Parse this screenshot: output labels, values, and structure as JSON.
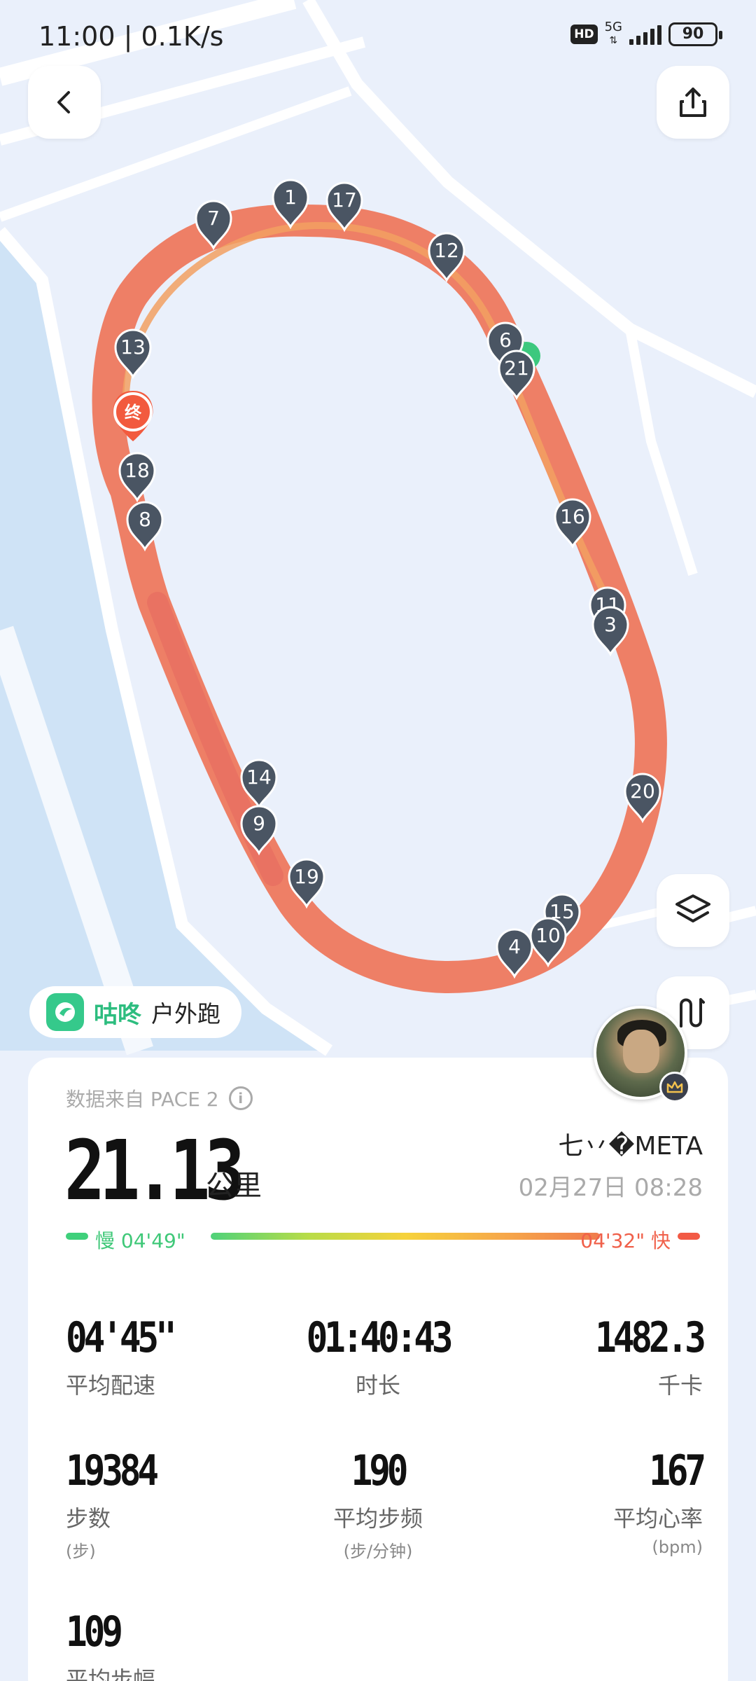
{
  "status_bar": {
    "time": "11:00 | 0.1K/s",
    "hd": "HD",
    "network": "5G",
    "battery": "90"
  },
  "icons": {
    "back": "back-arrow-icon",
    "share": "share-icon",
    "layers": "layers-icon",
    "route_toggle": "route-icon"
  },
  "map": {
    "end_marker": "终",
    "km_markers": [
      "1",
      "17",
      "7",
      "12",
      "6",
      "21",
      "13",
      "18",
      "8",
      "16",
      "11",
      "3",
      "14",
      "9",
      "20",
      "19",
      "15",
      "10",
      "4"
    ]
  },
  "app": {
    "name": "咕咚",
    "activity": "户外跑"
  },
  "summary": {
    "source": "数据来自 PACE 2",
    "distance": "21.13",
    "distance_unit": "公里",
    "user_name": "七丷�META",
    "date": "02月27日 08:28",
    "pace_slow": "慢 04'49\"",
    "pace_fast": "04'32\" 快"
  },
  "stats": [
    {
      "value": "04'45\"",
      "label": "平均配速",
      "unit": ""
    },
    {
      "value": "01:40:43",
      "label": "时长",
      "unit": ""
    },
    {
      "value": "1482.3",
      "label": "千卡",
      "unit": ""
    },
    {
      "value": "19384",
      "label": "步数",
      "unit": "(步)"
    },
    {
      "value": "190",
      "label": "平均步频",
      "unit": "(步/分钟)"
    },
    {
      "value": "167",
      "label": "平均心率",
      "unit": "(bpm)"
    },
    {
      "value": "109",
      "label": "平均步幅",
      "unit": ""
    }
  ],
  "colors": {
    "track": "#ee7f66",
    "marker": "#4a5563",
    "accent_green": "#2dbd7f",
    "fast_red": "#f25a45"
  }
}
